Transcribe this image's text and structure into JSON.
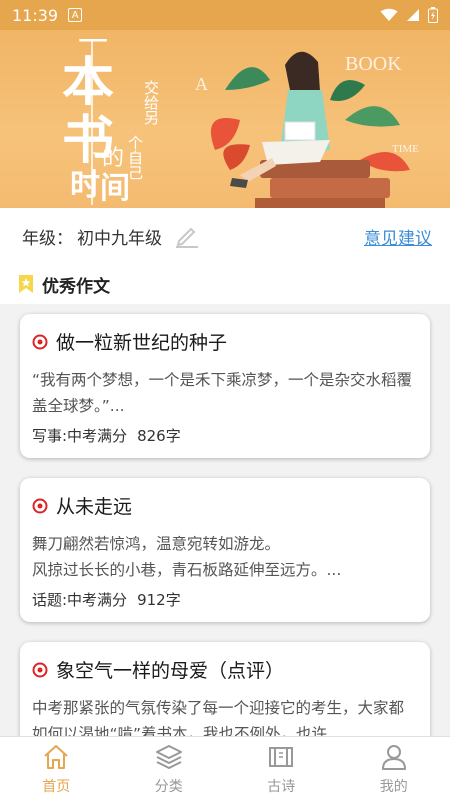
{
  "status_bar": {
    "time": "11:39",
    "notification_icon": "A"
  },
  "banner": {
    "title_chars": [
      "一",
      "本",
      "书",
      "的",
      "时",
      "间"
    ],
    "subtitle_line1": "交给另",
    "subtitle_line2": "个自己",
    "deco_text_1": "A",
    "deco_text_2": "BOOK",
    "deco_text_3": "TIME"
  },
  "grade": {
    "label": "年级：",
    "value": "初中九年级",
    "feedback_link": "意见建议"
  },
  "section": {
    "title": "优秀作文"
  },
  "articles": [
    {
      "title": "做一粒新世纪的种子",
      "excerpt": "“我有两个梦想，一个是禾下乘凉梦，一个是杂交水稻覆盖全球梦。”...",
      "category": "写事:中考满分",
      "word_count": "826字"
    },
    {
      "title": "从未走远",
      "excerpt": "舞刀翩然若惊鸿，温意宛转如游龙。\n        风掠过长长的小巷，青石板路延伸至远方。...",
      "category": "话题:中考满分",
      "word_count": "912字"
    },
    {
      "title": "象空气一样的母爱（点评）",
      "excerpt": "中考那紧张的气氛传染了每一个迎接它的考生，大家都如何以渴地“啃”着书本，我也不例外，也许",
      "category": "",
      "word_count": ""
    }
  ],
  "nav": {
    "home": "首页",
    "category": "分类",
    "poetry": "古诗",
    "mine": "我的"
  },
  "colors": {
    "accent": "#e6a64e",
    "link": "#3a8dd8",
    "target_red": "#e02424"
  }
}
